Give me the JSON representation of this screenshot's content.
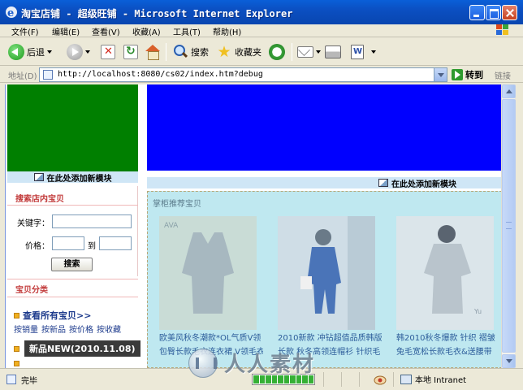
{
  "window": {
    "title": "淘宝店铺 - 超级旺铺 - Microsoft Internet Explorer"
  },
  "menu": {
    "items": [
      "文件(F)",
      "编辑(E)",
      "查看(V)",
      "收藏(A)",
      "工具(T)",
      "帮助(H)"
    ]
  },
  "toolbar": {
    "back_label": "后退",
    "search_label": "搜索",
    "favorites_label": "收藏夹"
  },
  "address": {
    "label": "地址(D)",
    "url": "http://localhost:8080/cs02/index.htm?debug",
    "go_label": "转到",
    "links_label": "链接"
  },
  "page": {
    "colors": {
      "green_block": "#007f00",
      "blue_banner": "#0000ff",
      "rec_panel_bg": "#bfe8f0"
    },
    "add_module_label": "在此处添加新模块",
    "search_panel": {
      "title": "搜索店内宝贝",
      "keyword_label": "关键字：",
      "price_label": "价格：",
      "to_label": "到",
      "button_label": "搜索"
    },
    "category_panel": {
      "title": "宝贝分类",
      "all_label": "查看所有宝贝>>",
      "links": [
        "按销量",
        "按新品",
        "按价格",
        "按收藏"
      ],
      "new_tag": "新品NEW(2010.11.08)"
    },
    "recommend": {
      "title": "掌柜推荐宝贝",
      "products": [
        {
          "caption_1": "欧美风秋冬潮款*OL气质V领",
          "caption_2": "包臀长款毛衣连衣裙 V领毛衣"
        },
        {
          "caption_1": "2010新款 冲钻超值品质韩版",
          "caption_2": "长款 秋冬高领连帽衫 针织毛"
        },
        {
          "caption_1": "韩2010秋冬爆款 针织 褶皱",
          "caption_2": "兔毛宽松长款毛衣&送腰带"
        }
      ]
    }
  },
  "status": {
    "text": "完毕",
    "zone": "本地 Intranet",
    "progress_segments": 10
  },
  "watermark": {
    "text": "人人素材"
  }
}
